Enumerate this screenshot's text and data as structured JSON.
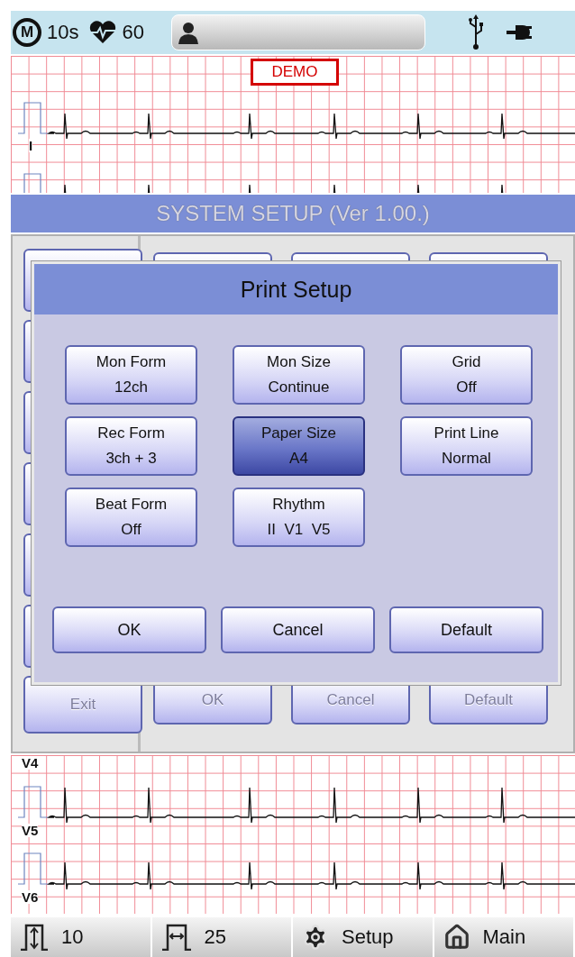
{
  "status_bar": {
    "mode_badge": "M",
    "duration": "10s",
    "heart_rate": "60"
  },
  "ecg_top": {
    "demo_label": "DEMO",
    "leads": [
      {
        "label": "I"
      }
    ]
  },
  "system_setup": {
    "title": "SYSTEM SETUP (Ver 1.00.)",
    "side_buttons": [
      {
        "label": "Exit",
        "disabled": true
      }
    ],
    "footer_buttons": [
      {
        "label": "OK",
        "disabled": true
      },
      {
        "label": "Cancel",
        "disabled": true
      },
      {
        "label": "Default",
        "disabled": true
      }
    ]
  },
  "dialog": {
    "title": "Print Setup",
    "options": [
      {
        "label": "Mon Form",
        "value": "12ch",
        "selected": false
      },
      {
        "label": "Mon Size",
        "value": "Continue",
        "selected": false
      },
      {
        "label": "Grid",
        "value": "Off",
        "selected": false
      },
      {
        "label": "Rec Form",
        "value": "3ch + 3",
        "selected": false
      },
      {
        "label": "Paper Size",
        "value": "A4",
        "selected": true
      },
      {
        "label": "Print Line",
        "value": "Normal",
        "selected": false
      },
      {
        "label": "Beat Form",
        "value": "Off",
        "selected": false
      },
      {
        "label": "Rhythm",
        "value": "II  V1  V5",
        "selected": false
      }
    ],
    "buttons": [
      "OK",
      "Cancel",
      "Default"
    ]
  },
  "ecg_bottom": {
    "leads": [
      {
        "label": "V4"
      },
      {
        "label": "V5"
      },
      {
        "label": "V6"
      }
    ]
  },
  "toolbar": [
    {
      "kind": "gain",
      "label": "10"
    },
    {
      "kind": "speed",
      "label": "25"
    },
    {
      "kind": "setup",
      "label": "Setup"
    },
    {
      "kind": "home",
      "label": "Main"
    }
  ]
}
